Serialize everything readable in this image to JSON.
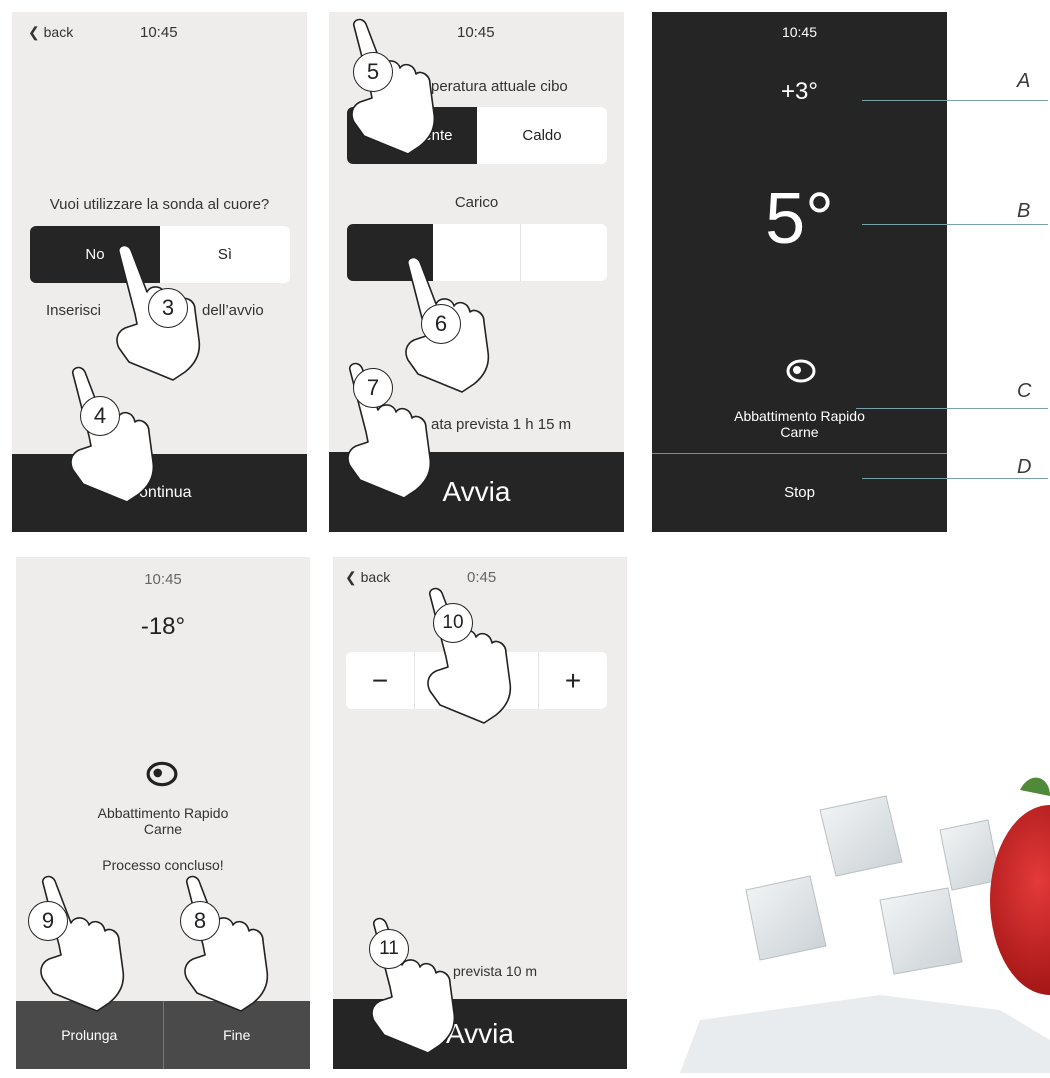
{
  "screen1": {
    "back_label": "back",
    "time": "10:45",
    "question": "Vuoi utilizzare la sonda al cuore?",
    "option_no": "No",
    "option_si": "Sì",
    "hint_left": "Inserisci",
    "hint_right": "dell’avvio",
    "continue_label": "Continua"
  },
  "screen2": {
    "time": "10:45",
    "food_temp_label": "peratura attuale cibo",
    "option_ambient": "T° ambiente",
    "option_hot": "Caldo",
    "load_label": "Carico",
    "duration": "ata prevista 1 h 15 m",
    "start_label": "Avvia"
  },
  "screen3": {
    "time": "10:45",
    "temp_small": "+3°",
    "temp_large": "5°",
    "program_line1": "Abbattimento Rapido",
    "program_line2": "Carne",
    "stop_label": "Stop",
    "callouts": [
      "A",
      "B",
      "C",
      "D"
    ]
  },
  "screen4": {
    "time": "10:45",
    "temp": "-18°",
    "program_line1": "Abbattimento Rapido",
    "program_line2": "Carne",
    "status": "Processo concluso!",
    "extend_label": "Prolunga",
    "end_label": "Fine"
  },
  "screen5": {
    "back_label": "back",
    "time": "0:45",
    "minus": "−",
    "value": "10 m",
    "plus": "+",
    "duration": "prevista 10 m",
    "start_label": "Avvia"
  },
  "steps": [
    "3",
    "4",
    "5",
    "6",
    "7",
    "8",
    "9",
    "10",
    "11"
  ],
  "icons": [
    "chevron-left-icon",
    "meat-icon",
    "pointing-hand-icon"
  ]
}
